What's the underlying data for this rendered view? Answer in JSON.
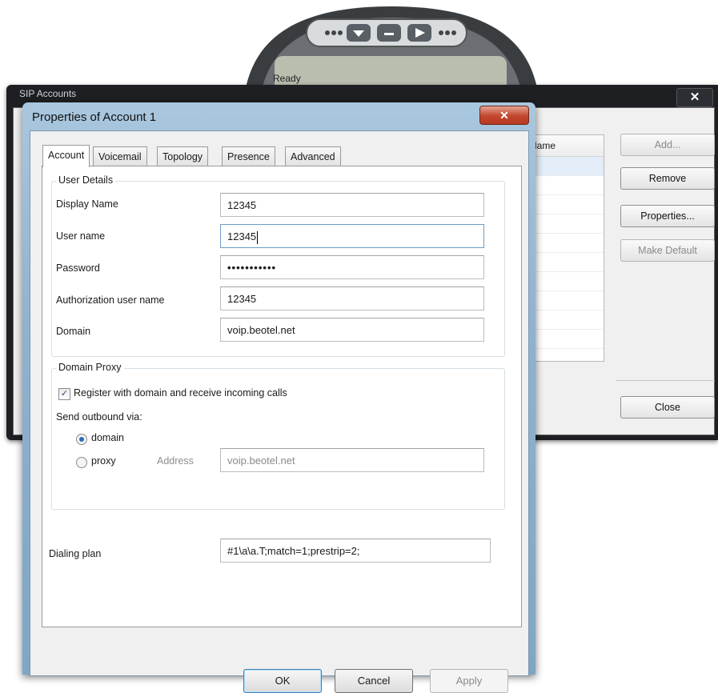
{
  "phone": {
    "status": "Ready"
  },
  "sip_window": {
    "title": "SIP Accounts",
    "close_glyph": "✕",
    "list_header": "Name",
    "buttons": {
      "add": "Add...",
      "remove": "Remove",
      "properties": "Properties...",
      "make_default": "Make Default",
      "close": "Close"
    }
  },
  "dialog": {
    "title": "Properties of Account 1",
    "close_glyph": "✕",
    "tabs": [
      "Account",
      "Voicemail",
      "Topology",
      "Presence",
      "Advanced"
    ],
    "active_tab": "Account",
    "user_details": {
      "group_label": "User Details",
      "display_name_label": "Display Name",
      "display_name": "12345",
      "user_name_label": "User name",
      "user_name": "12345",
      "password_label": "Password",
      "password": "•••••••••••",
      "auth_user_label": "Authorization user name",
      "auth_user": "12345",
      "domain_label": "Domain",
      "domain": "voip.beotel.net"
    },
    "domain_proxy": {
      "group_label": "Domain Proxy",
      "register_label": "Register with domain and receive incoming calls",
      "register_checked": true,
      "send_via_label": "Send outbound via:",
      "domain_option": "domain",
      "proxy_option": "proxy",
      "selected": "domain",
      "address_label": "Address",
      "address": "voip.beotel.net"
    },
    "dialing_plan_label": "Dialing plan",
    "dialing_plan": "#1\\a\\a.T;match=1;prestrip=2;",
    "buttons": {
      "ok": "OK",
      "cancel": "Cancel",
      "apply": "Apply"
    }
  }
}
